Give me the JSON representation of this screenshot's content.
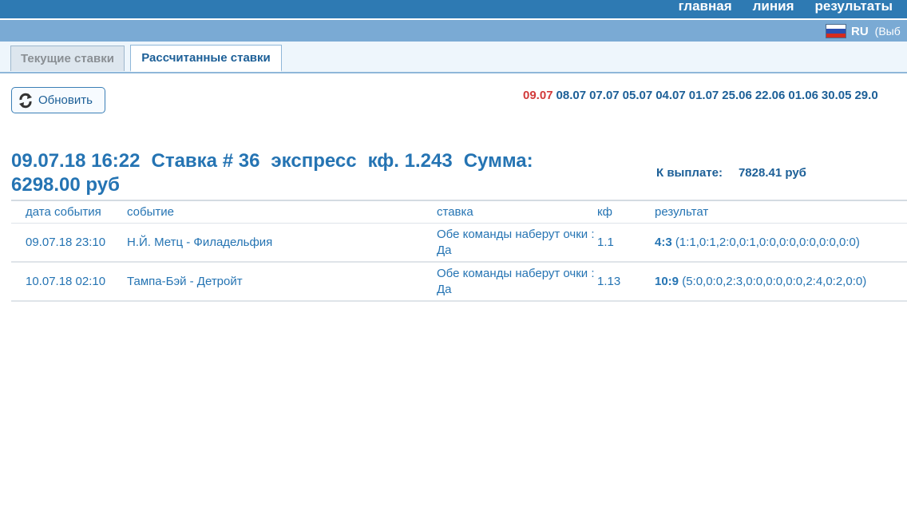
{
  "nav": {
    "items": [
      "главная",
      "линия",
      "результаты"
    ]
  },
  "lang": {
    "code": "RU",
    "select_label": "(Выб"
  },
  "tabs": {
    "current": "Текущие ставки",
    "settled": "Рассчитанные ставки"
  },
  "refresh": {
    "label": "Обновить",
    "icon": "refresh-icon"
  },
  "dates": [
    "09.07",
    "08.07",
    "07.07",
    "05.07",
    "04.07",
    "01.07",
    "25.06",
    "22.06",
    "01.06",
    "30.05",
    "29.0"
  ],
  "active_date": "09.07",
  "bet": {
    "datetime": "09.07.18 16:22",
    "number": "Ставка # 36",
    "type": "экспресс",
    "kf": "кф. 1.243",
    "sum_label": "Сумма:",
    "sum_value": "6298.00 руб",
    "payout_label": "К выплате:",
    "payout_value": "7828.41 руб"
  },
  "table": {
    "headers": [
      "дата события",
      "событие",
      "ставка",
      "кф",
      "результат"
    ],
    "rows": [
      {
        "date": "09.07.18 23:10",
        "event": "Н.Й. Метц - Филадельфия",
        "bet": "Обе команды наберут очки : Да",
        "kf": "1.1",
        "score": "4:3",
        "detail": "(1:1,0:1,2:0,0:1,0:0,0:0,0:0,0:0,0:0)"
      },
      {
        "date": "10.07.18 02:10",
        "event": "Тампа-Бэй - Детройт",
        "bet": "Обе команды наберут очки : Да",
        "kf": "1.13",
        "score": "10:9",
        "detail": "(5:0,0:0,2:3,0:0,0:0,0:0,2:4,0:2,0:0)"
      }
    ]
  },
  "colors": {
    "topbar": "#2e7ab3",
    "langbar": "#7aaad4",
    "primary_text": "#2574b3",
    "active_date": "#d23a3a"
  }
}
